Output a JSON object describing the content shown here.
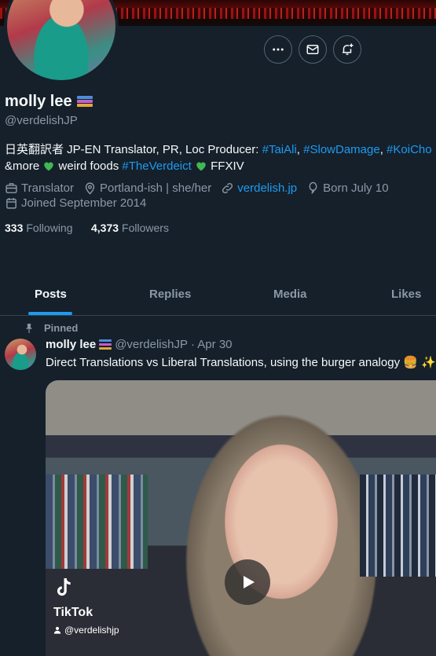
{
  "profile": {
    "name": "molly lee",
    "handle": "@verdelishJP",
    "bio": {
      "part1": "日英翻訳者 JP-EN Translator, PR, Loc Producer: ",
      "tag1": "#TaiAli",
      "sep1": ", ",
      "tag2": "#SlowDamage",
      "sep2": ", ",
      "tag3": "#KoiCho",
      "part2": "&more ",
      "part3": " weird foods ",
      "tag4": "#TheVerdeict",
      "part4": " FFXIV"
    },
    "meta": {
      "job": "Translator",
      "location": "Portland-ish | she/her",
      "website": "verdelish.jp",
      "born": "Born July 10",
      "joined": "Joined September 2014"
    },
    "following_count": "333",
    "following_label": "Following",
    "followers_count": "4,373",
    "followers_label": "Followers"
  },
  "tabs": [
    {
      "label": "Posts"
    },
    {
      "label": "Replies"
    },
    {
      "label": "Media"
    },
    {
      "label": "Likes"
    }
  ],
  "pinned_post": {
    "pinned_label": "Pinned",
    "author": "molly lee",
    "handle": "@verdelishJP",
    "date": "· Apr 30",
    "text": "Direct Translations vs Liberal Translations, using the burger analogy 🍔 ✨",
    "tiktok_brand": "TikTok",
    "tiktok_user": "@verdelishjp"
  },
  "colors": {
    "background": "#15202b",
    "accent": "#1d9bf0",
    "muted": "#8b98a5",
    "heart": "#3fb950"
  }
}
